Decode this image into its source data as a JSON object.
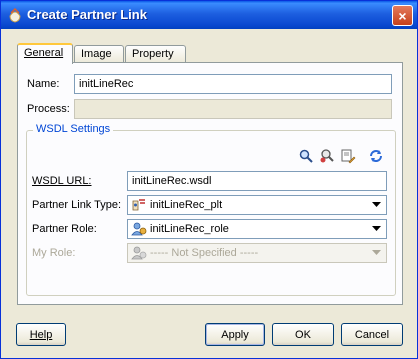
{
  "window": {
    "title": "Create Partner Link",
    "close_glyph": "×"
  },
  "tabs": [
    {
      "label": "General",
      "active": true
    },
    {
      "label": "Image",
      "active": false
    },
    {
      "label": "Property",
      "active": false
    }
  ],
  "general": {
    "name_label": "Name:",
    "name_value": "initLineRec",
    "process_label": "Process:",
    "process_value": ""
  },
  "wsdl_settings": {
    "title": "WSDL Settings",
    "toolbar_icons": [
      "search-icon",
      "service-explorer-icon",
      "edit-wsdl-icon",
      "refresh-icon"
    ],
    "wsdl_url_label": "WSDL URL:",
    "wsdl_url_value": "initLineRec.wsdl",
    "partner_link_type_label": "Partner Link Type:",
    "partner_link_type_value": "initLineRec_plt",
    "partner_role_label": "Partner Role:",
    "partner_role_value": "initLineRec_role",
    "my_role_label": "My Role:",
    "my_role_value": "----- Not Specified -----"
  },
  "buttons": {
    "help": "Help",
    "apply": "Apply",
    "ok": "OK",
    "cancel": "Cancel"
  },
  "colors": {
    "titlebar": "#0a48d0",
    "accent": "#0046d5",
    "dialog_bg": "#ece9d8"
  }
}
